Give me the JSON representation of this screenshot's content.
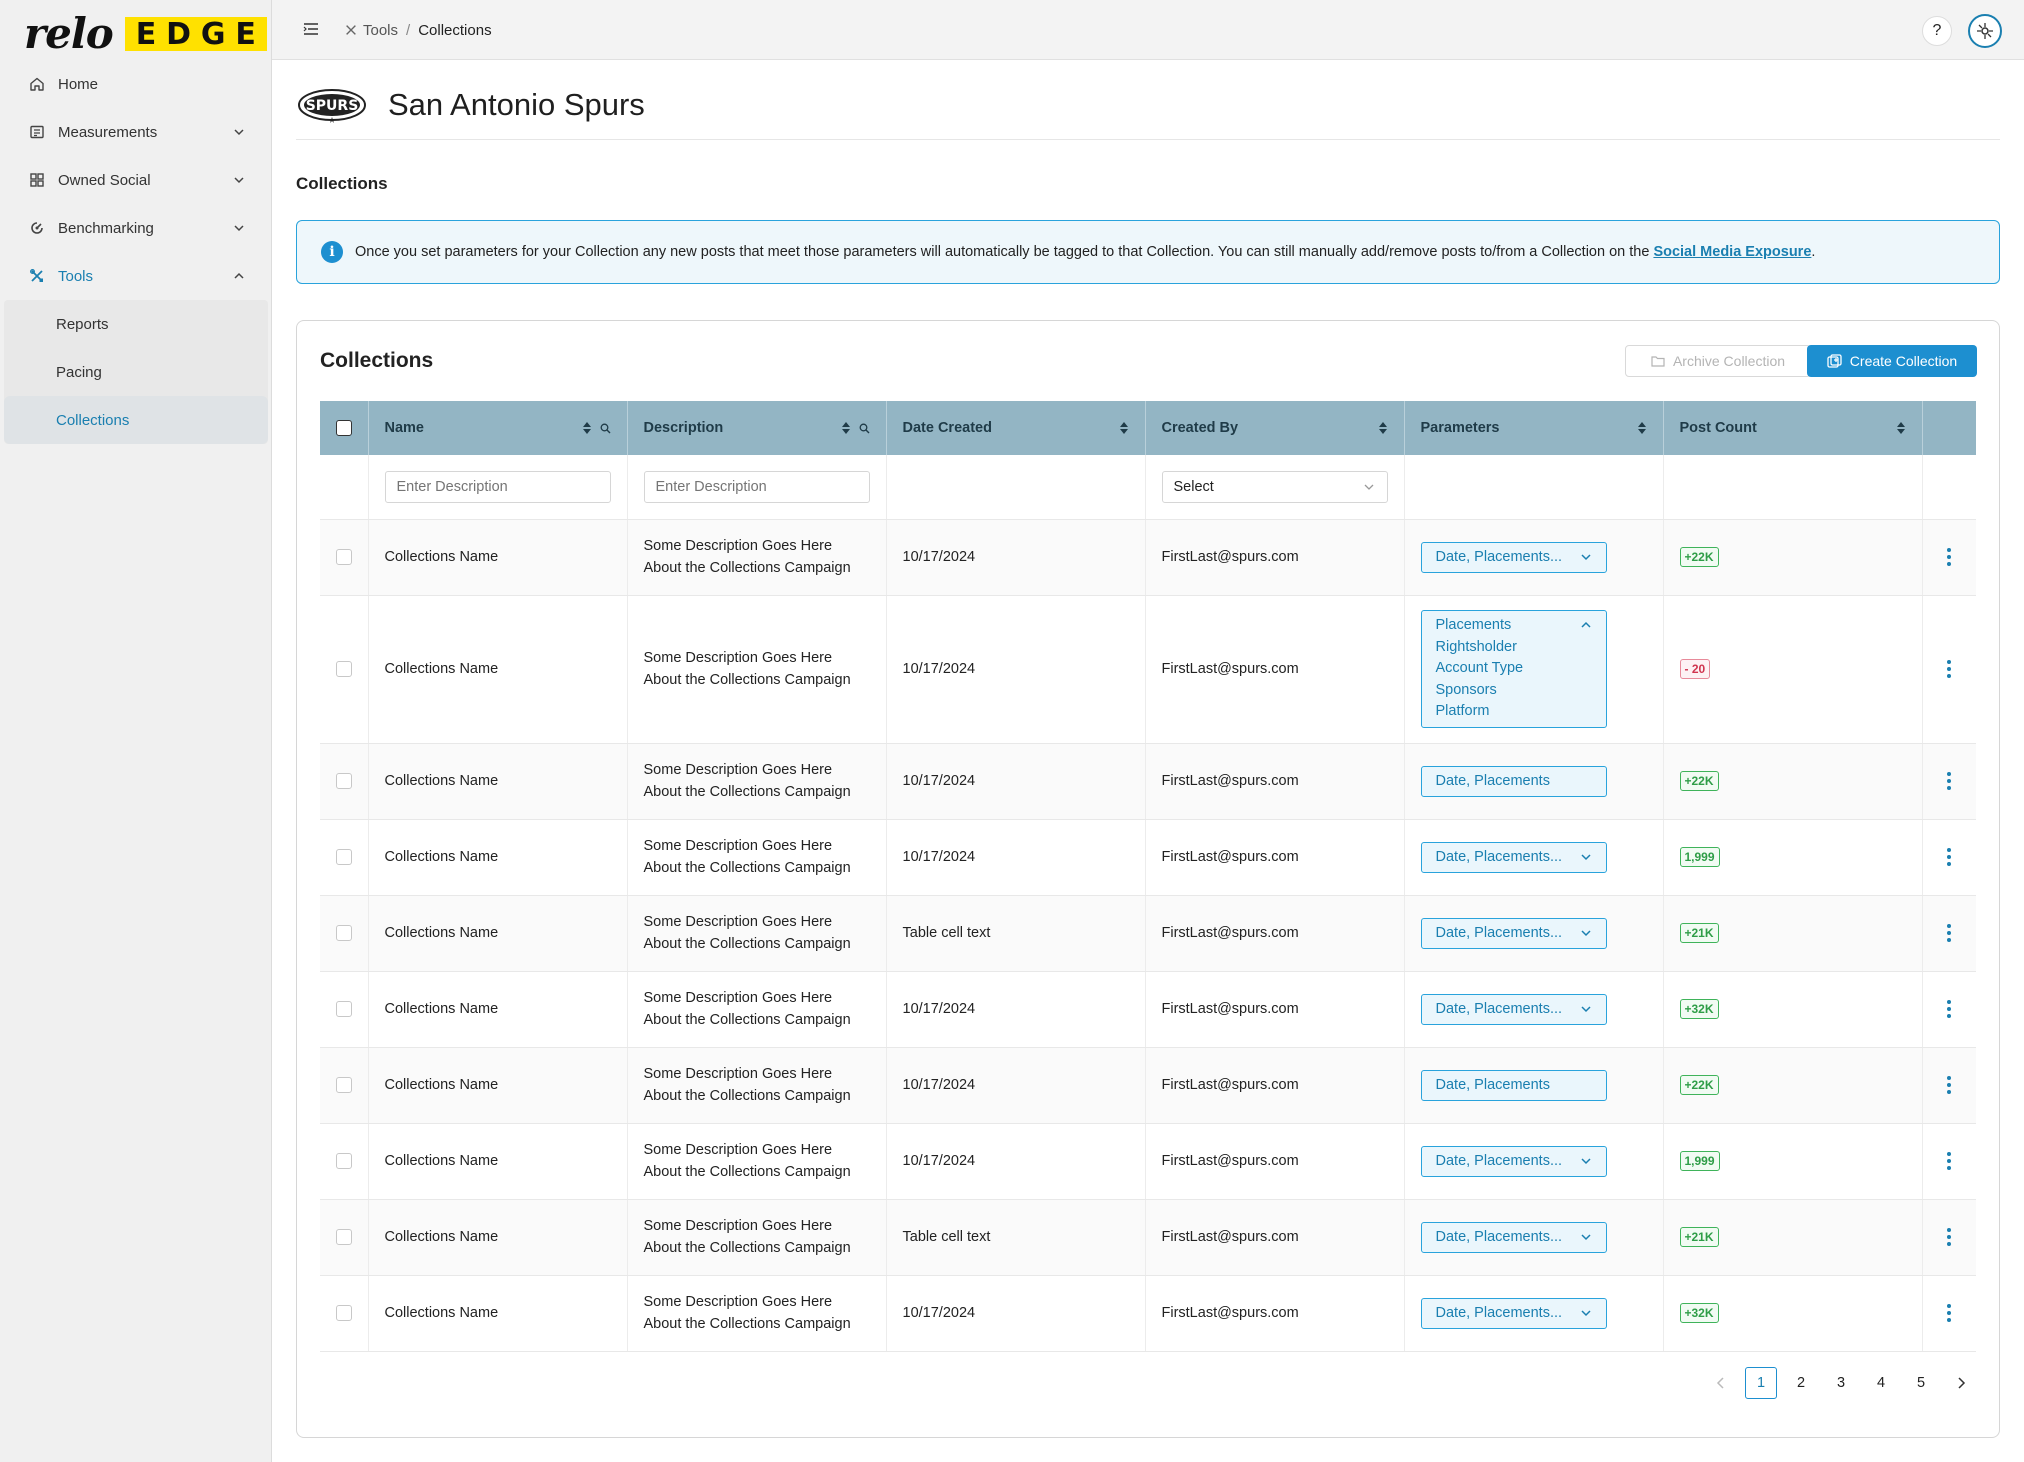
{
  "brand": {
    "logo_word": "relo",
    "logo_badge": [
      "E",
      "D",
      "G",
      "E"
    ]
  },
  "sidebar": {
    "items": [
      {
        "label": "Home",
        "icon": "home-icon"
      },
      {
        "label": "Measurements",
        "icon": "measurements-icon"
      },
      {
        "label": "Owned Social",
        "icon": "grid-icon"
      },
      {
        "label": "Benchmarking",
        "icon": "benchmark-icon"
      },
      {
        "label": "Tools",
        "icon": "tools-icon"
      }
    ],
    "sub_items": [
      "Reports",
      "Pacing",
      "Collections"
    ]
  },
  "topbar": {
    "crumb_tools": "Tools",
    "crumb_sep": "/",
    "crumb_current": "Collections",
    "help": "?"
  },
  "team": {
    "name": "San Antonio Spurs",
    "logo_text": "SPURS"
  },
  "page": {
    "section_title": "Collections"
  },
  "info": {
    "text": "Once you set parameters for your Collection any new posts that meet those parameters will automatically be tagged to that Collection. You can still manually add/remove posts to/from a Collection on the ",
    "link": "Social Media Exposure",
    "suffix": "."
  },
  "card": {
    "title": "Collections",
    "archive_label": "Archive Collection",
    "create_label": "Create Collection"
  },
  "table": {
    "headers": [
      "Name",
      "Description",
      "Date Created",
      "Created By",
      "Parameters",
      "Post Count"
    ],
    "filters": {
      "name_placeholder": "Enter Description",
      "desc_placeholder": "Enter Description",
      "created_by_select": "Select"
    },
    "rows": [
      {
        "name": "Collections Name",
        "desc1": "Some Description Goes Here",
        "desc2": "About the Collections Campaign",
        "date": "10/17/2024",
        "by": "FirstLast@spurs.com",
        "params": "Date, Placements...",
        "count": "+22K"
      },
      {
        "name": "Collections Name",
        "desc1": "Some Description Goes Here",
        "desc2": "About the Collections Campaign",
        "date": "10/17/2024",
        "by": "FirstLast@spurs.com",
        "params_list": [
          "Placements",
          "Rightsholder",
          "Account Type",
          "Sponsors",
          "Platform"
        ],
        "count": "- 20"
      },
      {
        "name": "Collections Name",
        "desc1": "Some Description Goes Here",
        "desc2": "About the Collections Campaign",
        "date": "10/17/2024",
        "by": "FirstLast@spurs.com",
        "params": "Date, Placements",
        "count": "+22K"
      },
      {
        "name": "Collections Name",
        "desc1": "Some Description Goes Here",
        "desc2": "About the Collections Campaign",
        "date": "10/17/2024",
        "by": "FirstLast@spurs.com",
        "params": "Date, Placements...",
        "count": "1,999"
      },
      {
        "name": "Collections Name",
        "desc1": "Some Description Goes Here",
        "desc2": "About the Collections Campaign",
        "date": "Table cell text",
        "by": "FirstLast@spurs.com",
        "params": "Date, Placements...",
        "count": "+21K"
      },
      {
        "name": "Collections Name",
        "desc1": "Some Description Goes Here",
        "desc2": "About the Collections Campaign",
        "date": "10/17/2024",
        "by": "FirstLast@spurs.com",
        "params": "Date, Placements...",
        "count": "+32K"
      },
      {
        "name": "Collections Name",
        "desc1": "Some Description Goes Here",
        "desc2": "About the Collections Campaign",
        "date": "10/17/2024",
        "by": "FirstLast@spurs.com",
        "params": "Date, Placements",
        "count": "+22K"
      },
      {
        "name": "Collections Name",
        "desc1": "Some Description Goes Here",
        "desc2": "About the Collections Campaign",
        "date": "10/17/2024",
        "by": "FirstLast@spurs.com",
        "params": "Date, Placements...",
        "count": "1,999"
      },
      {
        "name": "Collections Name",
        "desc1": "Some Description Goes Here",
        "desc2": "About the Collections Campaign",
        "date": "Table cell text",
        "by": "FirstLast@spurs.com",
        "params": "Date, Placements...",
        "count": "+21K"
      },
      {
        "name": "Collections Name",
        "desc1": "Some Description Goes Here",
        "desc2": "About the Collections Campaign",
        "date": "10/17/2024",
        "by": "FirstLast@spurs.com",
        "params": "Date, Placements...",
        "count": "+32K"
      }
    ]
  },
  "pagination": {
    "pages": [
      "1",
      "2",
      "3",
      "4",
      "5"
    ],
    "current": "1"
  },
  "colors": {
    "accent": "#1d8fd0",
    "header_bg": "#93b5c4",
    "logo_yellow": "#ffe100",
    "positive": "#2e9d47",
    "negative": "#d0354f"
  }
}
